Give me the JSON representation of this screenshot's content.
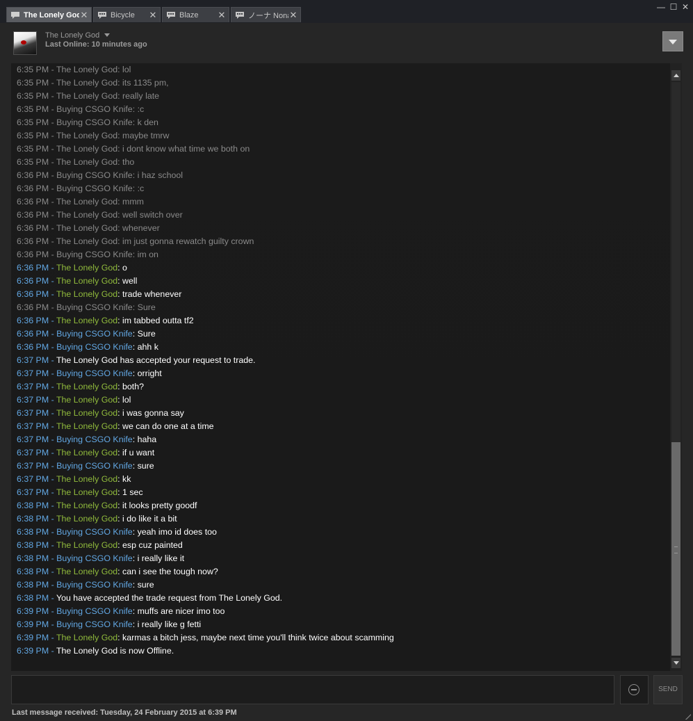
{
  "tabs": [
    {
      "label": "The Lonely God",
      "active": true
    },
    {
      "label": "Bicycle",
      "active": false
    },
    {
      "label": "Blaze",
      "active": false
    },
    {
      "label": "ノーナ Nona",
      "active": false
    }
  ],
  "window_controls": {
    "minimize": "—",
    "maximize": "☐",
    "close": "✕"
  },
  "header": {
    "friend_name": "The Lonely God",
    "last_online": "Last Online: 10 minutes ago"
  },
  "messages": [
    {
      "time": "6:35 PM",
      "sender": "The Lonely God",
      "text": "lol",
      "kind": "old"
    },
    {
      "time": "6:35 PM",
      "sender": "The Lonely God",
      "text": "its 1135 pm,",
      "kind": "old"
    },
    {
      "time": "6:35 PM",
      "sender": "The Lonely God",
      "text": "really late",
      "kind": "old"
    },
    {
      "time": "6:35 PM",
      "sender": "Buying CSGO Knife",
      "text": ":c",
      "kind": "old"
    },
    {
      "time": "6:35 PM",
      "sender": "Buying CSGO Knife",
      "text": "k den",
      "kind": "old"
    },
    {
      "time": "6:35 PM",
      "sender": "The Lonely God",
      "text": "maybe tmrw",
      "kind": "old"
    },
    {
      "time": "6:35 PM",
      "sender": "The Lonely God",
      "text": "i dont know what time we both on",
      "kind": "old"
    },
    {
      "time": "6:35 PM",
      "sender": "The Lonely God",
      "text": "tho",
      "kind": "old"
    },
    {
      "time": "6:36 PM",
      "sender": "Buying CSGO Knife",
      "text": "i haz school",
      "kind": "old"
    },
    {
      "time": "6:36 PM",
      "sender": "Buying CSGO Knife",
      "text": ":c",
      "kind": "old"
    },
    {
      "time": "6:36 PM",
      "sender": "The Lonely God",
      "text": "mmm",
      "kind": "old"
    },
    {
      "time": "6:36 PM",
      "sender": "The Lonely God",
      "text": "well switch over",
      "kind": "old"
    },
    {
      "time": "6:36 PM",
      "sender": "The Lonely God",
      "text": "whenever",
      "kind": "old"
    },
    {
      "time": "6:36 PM",
      "sender": "The Lonely God",
      "text": "im just gonna rewatch guilty crown",
      "kind": "old"
    },
    {
      "time": "6:36 PM",
      "sender": "Buying CSGO Knife",
      "text": "im on",
      "kind": "old"
    },
    {
      "time": "6:36 PM",
      "sender": "The Lonely God",
      "text": "o",
      "kind": "them"
    },
    {
      "time": "6:36 PM",
      "sender": "The Lonely God",
      "text": "well",
      "kind": "them"
    },
    {
      "time": "6:36 PM",
      "sender": "The Lonely God",
      "text": "trade whenever",
      "kind": "them"
    },
    {
      "time": "6:36 PM",
      "sender": "Buying CSGO Knife",
      "text": "Sure",
      "kind": "old"
    },
    {
      "time": "6:36 PM",
      "sender": "The Lonely God",
      "text": "im tabbed outta tf2",
      "kind": "them"
    },
    {
      "time": "6:36 PM",
      "sender": "Buying CSGO Knife",
      "text": "Sure",
      "kind": "me"
    },
    {
      "time": "6:36 PM",
      "sender": "Buying CSGO Knife",
      "text": "ahh k",
      "kind": "me"
    },
    {
      "time": "6:37 PM",
      "sender": "",
      "text": "The Lonely God has accepted your request to trade.",
      "kind": "sys"
    },
    {
      "time": "6:37 PM",
      "sender": "Buying CSGO Knife",
      "text": "orright",
      "kind": "me"
    },
    {
      "time": "6:37 PM",
      "sender": "The Lonely God",
      "text": "both?",
      "kind": "them"
    },
    {
      "time": "6:37 PM",
      "sender": "The Lonely God",
      "text": "lol",
      "kind": "them"
    },
    {
      "time": "6:37 PM",
      "sender": "The Lonely God",
      "text": "i was gonna say",
      "kind": "them"
    },
    {
      "time": "6:37 PM",
      "sender": "The Lonely God",
      "text": "we can do one at a time",
      "kind": "them"
    },
    {
      "time": "6:37 PM",
      "sender": "Buying CSGO Knife",
      "text": "haha",
      "kind": "me"
    },
    {
      "time": "6:37 PM",
      "sender": "The Lonely God",
      "text": "if u want",
      "kind": "them"
    },
    {
      "time": "6:37 PM",
      "sender": "Buying CSGO Knife",
      "text": "sure",
      "kind": "me"
    },
    {
      "time": "6:37 PM",
      "sender": "The Lonely God",
      "text": "kk",
      "kind": "them"
    },
    {
      "time": "6:37 PM",
      "sender": "The Lonely God",
      "text": "1 sec",
      "kind": "them"
    },
    {
      "time": "6:38 PM",
      "sender": "The Lonely God",
      "text": "it looks pretty goodf",
      "kind": "them"
    },
    {
      "time": "6:38 PM",
      "sender": "The Lonely God",
      "text": "i do like it a bit",
      "kind": "them"
    },
    {
      "time": "6:38 PM",
      "sender": "Buying CSGO Knife",
      "text": "yeah imo id does too",
      "kind": "me"
    },
    {
      "time": "6:38 PM",
      "sender": "The Lonely God",
      "text": "esp cuz painted",
      "kind": "them"
    },
    {
      "time": "6:38 PM",
      "sender": "Buying CSGO Knife",
      "text": "i really like it",
      "kind": "me"
    },
    {
      "time": "6:38 PM",
      "sender": "The Lonely God",
      "text": "can i see the tough now?",
      "kind": "them"
    },
    {
      "time": "6:38 PM",
      "sender": "Buying CSGO Knife",
      "text": "sure",
      "kind": "me"
    },
    {
      "time": "6:38 PM",
      "sender": "",
      "text": "You have accepted the trade request from The Lonely God.",
      "kind": "sys"
    },
    {
      "time": "6:39 PM",
      "sender": "Buying CSGO Knife",
      "text": "muffs are nicer imo too",
      "kind": "me"
    },
    {
      "time": "6:39 PM",
      "sender": "Buying CSGO Knife",
      "text": "i really like g fetti",
      "kind": "me"
    },
    {
      "time": "6:39 PM",
      "sender": "The Lonely God",
      "text": "karmas a bitch jess, maybe next time you'll think twice about scamming",
      "kind": "them"
    },
    {
      "time": "6:39 PM",
      "sender": "",
      "text": "The Lonely God is now Offline.",
      "kind": "sys"
    }
  ],
  "input": {
    "placeholder": "",
    "value": ""
  },
  "send_label": "SEND",
  "status": "Last message received: Tuesday, 24 February 2015 at 6:39 PM",
  "colors": {
    "timestamp": "#62a7e3",
    "friend_name": "#90ba3c",
    "self_name": "#62a7e3",
    "history": "#8a8a8a",
    "message": "#ffffff"
  }
}
